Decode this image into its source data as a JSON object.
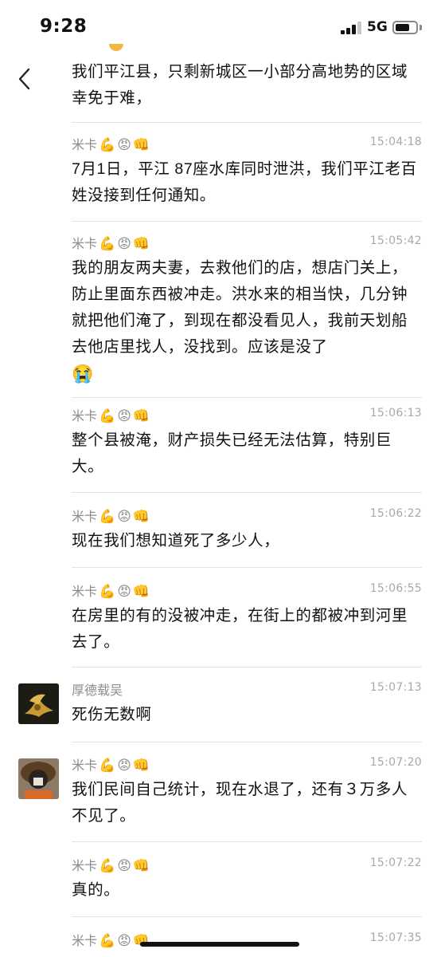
{
  "status": {
    "time": "9:28",
    "network": "5G"
  },
  "emoji": {
    "muscle": "💪",
    "angry": "😡",
    "fist": "👊",
    "cry": "😭"
  },
  "messages": [
    {
      "sender": "",
      "time": "",
      "text": "我们平江县，只剩新城区一小部分高地势的区域幸免于难，"
    },
    {
      "sender": "米卡",
      "time": "15:04:18",
      "text": "7月1日，平江 87座水库同时泄洪，我们平江老百姓没接到任何通知。"
    },
    {
      "sender": "米卡",
      "time": "15:05:42",
      "text": "我的朋友两夫妻，去救他们的店，想店门关上，防止里面东西被冲走。洪水来的相当快，几分钟就把他们淹了，到现在都没看见人，我前天划船去他店里找人，没找到。应该是没了"
    },
    {
      "sender": "米卡",
      "time": "15:06:13",
      "text": "整个县被淹，财产损失已经无法估算，特别巨大。"
    },
    {
      "sender": "米卡",
      "time": "15:06:22",
      "text": "现在我们想知道死了多少人，"
    },
    {
      "sender": "米卡",
      "time": "15:06:55",
      "text": "在房里的有的没被冲走，在街上的都被冲到河里去了。"
    },
    {
      "sender": "厚德载吴",
      "time": "15:07:13",
      "text": "死伤无数啊"
    },
    {
      "sender": "米卡",
      "time": "15:07:20",
      "text": "我们民间自己统计，现在水退了，还有３万多人不见了。"
    },
    {
      "sender": "米卡",
      "time": "15:07:22",
      "text": "真的。"
    },
    {
      "sender": "米卡",
      "time": "15:07:35",
      "text": ""
    }
  ]
}
